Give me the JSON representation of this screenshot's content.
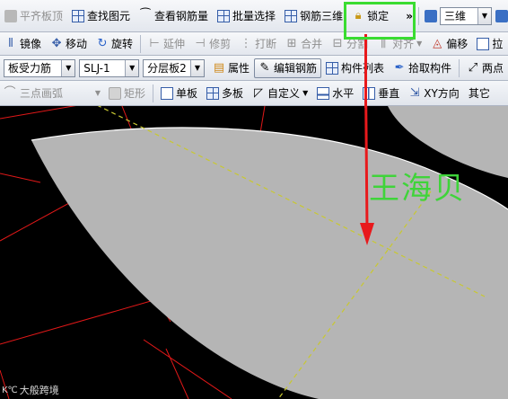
{
  "toolbar1": {
    "align_slab": "平齐板顶",
    "find_primitive": "查找图元",
    "view_rebar_qty": "查看钢筋量",
    "batch_select": "批量选择",
    "rebar_3d": "钢筋三维",
    "lock": "锁定",
    "view_mode": "三维",
    "more": "»"
  },
  "toolbar2": {
    "mirror": "镜像",
    "move": "移动",
    "rotate": "旋转",
    "extend": "延伸",
    "trim": "修剪",
    "break": "打断",
    "merge": "合并",
    "split": "分割",
    "align": "对齐",
    "offset": "偏移",
    "stretch": "拉"
  },
  "toolbar3": {
    "rebar_type": "板受力筋",
    "rebar_name": "SLJ-1",
    "layer": "分层板2",
    "properties": "属性",
    "edit_rebar": "编辑钢筋",
    "component_list": "构件列表",
    "pick_component": "拾取构件",
    "two_point": "两点"
  },
  "toolbar4": {
    "arc_mode": "三点画弧",
    "rectangle": "矩形",
    "single_slab": "单板",
    "multi_slab": "多板",
    "custom": "自定义",
    "horizontal": "水平",
    "vertical": "垂直",
    "xy_direction": "XY方向",
    "other": "其它"
  },
  "canvas": {
    "watermark": "王海贝",
    "corner_logo": "大般跨境",
    "colors": {
      "slab_fill": "#b5b5b5",
      "grid_line": "#e01818",
      "axis_dash": "#c8c832",
      "annotation_arrow": "#e8191c",
      "highlight_box": "#3adc31"
    }
  }
}
